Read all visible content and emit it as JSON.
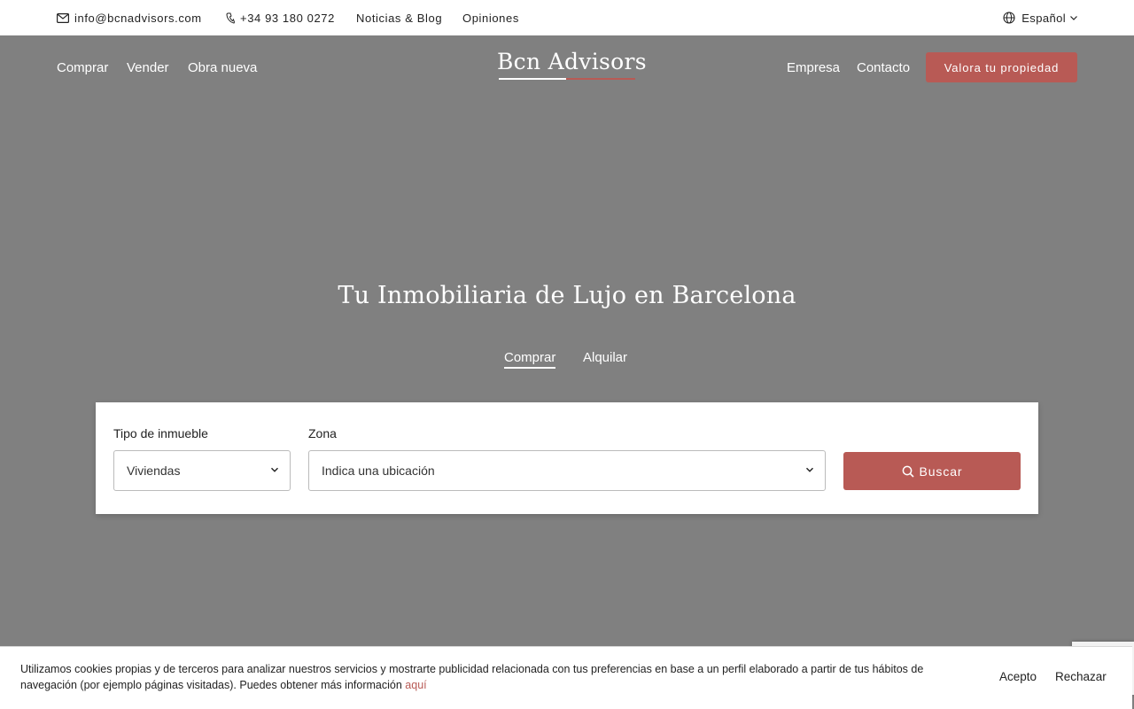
{
  "topbar": {
    "email": "info@bcnadvisors.com",
    "phone": "+34 93 180 0272",
    "links": [
      "Noticias & Blog",
      "Opiniones"
    ],
    "language": "Español"
  },
  "nav": {
    "left": [
      "Comprar",
      "Vender",
      "Obra nueva"
    ],
    "logo": "Bcn Advisors",
    "right": [
      "Empresa",
      "Contacto"
    ],
    "cta": "Valora tu propiedad"
  },
  "hero": {
    "title": "Tu Inmobiliaria de Lujo en Barcelona",
    "tabs": [
      {
        "label": "Comprar",
        "active": true
      },
      {
        "label": "Alquilar",
        "active": false
      }
    ]
  },
  "search": {
    "type_label": "Tipo de inmueble",
    "type_value": "Viviendas",
    "zone_label": "Zona",
    "zone_value": "Indica una ubicación",
    "button": "Buscar"
  },
  "cookie": {
    "text": "Utilizamos cookies propias y de terceros para analizar nuestros servicios y mostrarte publicidad relacionada con tus preferencias en base a un perfil elaborado a partir de tus hábitos de navegación (por ejemplo páginas visitadas). Puedes obtener más información",
    "link": "aquí",
    "accept": "Acepto",
    "reject": "Rechazar"
  },
  "colors": {
    "accent": "#b85a55",
    "hero_bg": "#808080",
    "white": "#ffffff"
  },
  "icons": [
    "mail-icon",
    "phone-icon",
    "globe-icon",
    "chevron-down-icon",
    "search-icon"
  ]
}
